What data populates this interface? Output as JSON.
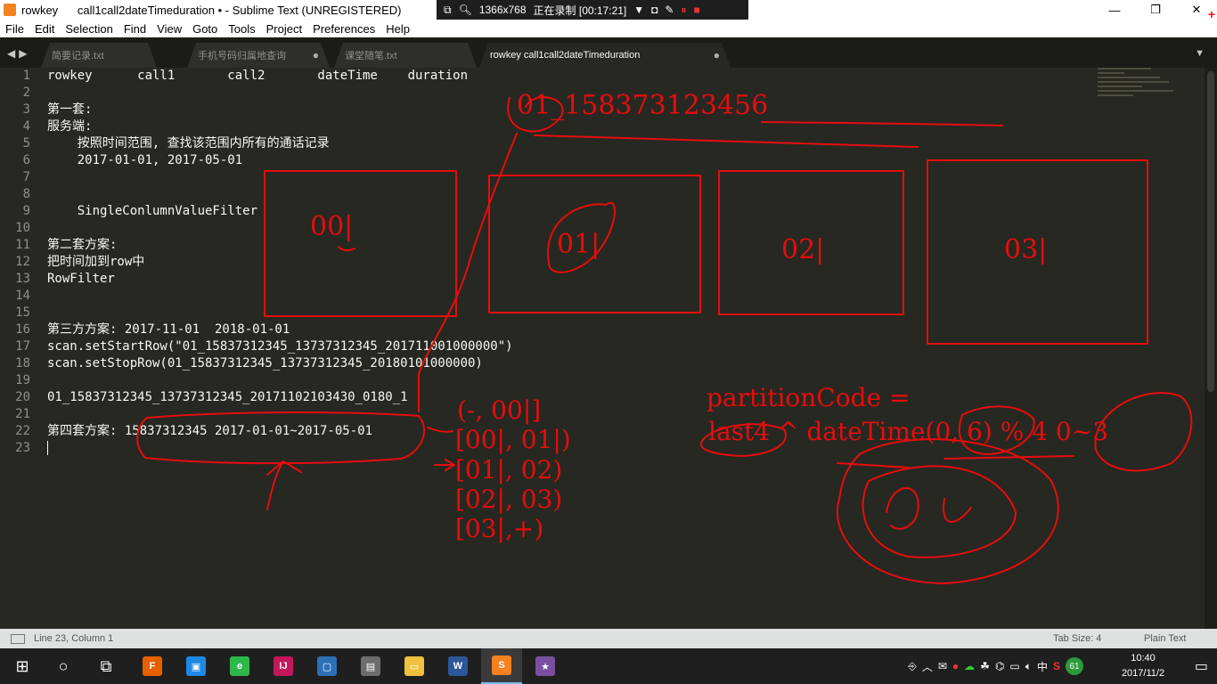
{
  "colors": {
    "editor_bg": "#272822",
    "annotation_red": "#e60d0d",
    "text": "#f8f8f2",
    "line_number": "#90908a"
  },
  "window": {
    "title": "rowkey      call1call2dateTimeduration • - Sublime Text (UNREGISTERED)",
    "controls": [
      "—",
      "❐",
      "✕"
    ]
  },
  "recorder": {
    "resolution": "1366x768",
    "status": "正在录制 [00:17:21]"
  },
  "menu": [
    "File",
    "Edit",
    "Selection",
    "Find",
    "View",
    "Goto",
    "Tools",
    "Project",
    "Preferences",
    "Help"
  ],
  "tabs": [
    {
      "label": "简要记录.txt",
      "close": ""
    },
    {
      "label": "手机号码归属地查询",
      "close": "●"
    },
    {
      "label": "课堂随笔.txt",
      "close": ""
    },
    {
      "label": "rowkey      call1󠀠󠀠call2󠀠󠀠dateTime󠀠duration",
      "close": "●"
    }
  ],
  "editor": {
    "line_numbers": [
      "1",
      "2",
      "3",
      "4",
      "5",
      "6",
      "7",
      "8",
      "9",
      "10",
      "11",
      "12",
      "13",
      "14",
      "15",
      "16",
      "17",
      "18",
      "19",
      "20",
      "21",
      "22",
      "23"
    ],
    "lines": [
      "rowkey      call1       call2       dateTime    duration",
      "",
      "第一套:",
      "服务端:",
      "    按照时间范围, 查找该范围内所有的通话记录",
      "    2017-01-01, 2017-05-01",
      "",
      "",
      "    SingleConlumnValueFilter",
      "",
      "第二套方案:",
      "把时间加到row中",
      "RowFilter",
      "",
      "",
      "第三方方案: 2017-11-01  2018-01-01",
      "scan.setStartRow(\"01_15837312345_13737312345_201711001000000\")",
      "scan.setStopRow(01_15837312345_13737312345_20180101000000)",
      "",
      "01_15837312345_13737312345_20171102103430_0180_1",
      "",
      "第四套方案: 15837312345 2017-01-01~2017-05-01",
      ""
    ]
  },
  "annotations": {
    "key_example": "01_158373123456",
    "partitions": [
      "00|",
      "01|",
      "02|",
      "03|"
    ],
    "ranges": [
      "(-, 00|]",
      "[00|, 01|)",
      "[01|, 02)",
      "[02|, 03)",
      "[03|,+)"
    ],
    "formula_line1": "partitionCode =",
    "formula_line2": "last4 ^ dateTime(0, 6) % 4 0~3"
  },
  "status": {
    "position": "Line 23, Column 1",
    "tab_size": "Tab Size: 4",
    "syntax": "Plain Text"
  },
  "taskbar": {
    "start_icon": "windows-logo-icon",
    "apps": [
      {
        "name": "firefox-icon",
        "glyph": "F",
        "color": "#e66000"
      },
      {
        "name": "remote-desktop-icon",
        "glyph": "▣",
        "color": "#1e88e5"
      },
      {
        "name": "browser-360-icon",
        "glyph": "e",
        "color": "#2fb84a"
      },
      {
        "name": "intellij-icon",
        "glyph": "IJ",
        "color": "#c2185b"
      },
      {
        "name": "virtualbox-icon",
        "glyph": "▢",
        "color": "#2c70b8"
      },
      {
        "name": "disk-manager-icon",
        "glyph": "▤",
        "color": "#6d6d6d"
      },
      {
        "name": "file-explorer-icon",
        "glyph": "▭",
        "color": "#f0c040"
      },
      {
        "name": "word-icon",
        "glyph": "W",
        "color": "#2b579a"
      },
      {
        "name": "sublime-text-icon",
        "glyph": "S",
        "color": "#f58220"
      },
      {
        "name": "game-launcher-icon",
        "glyph": "★",
        "color": "#7a4fa0"
      }
    ],
    "tray_badge": "61",
    "time": "10:40",
    "date": "2017/11/2",
    "ime": "中"
  }
}
